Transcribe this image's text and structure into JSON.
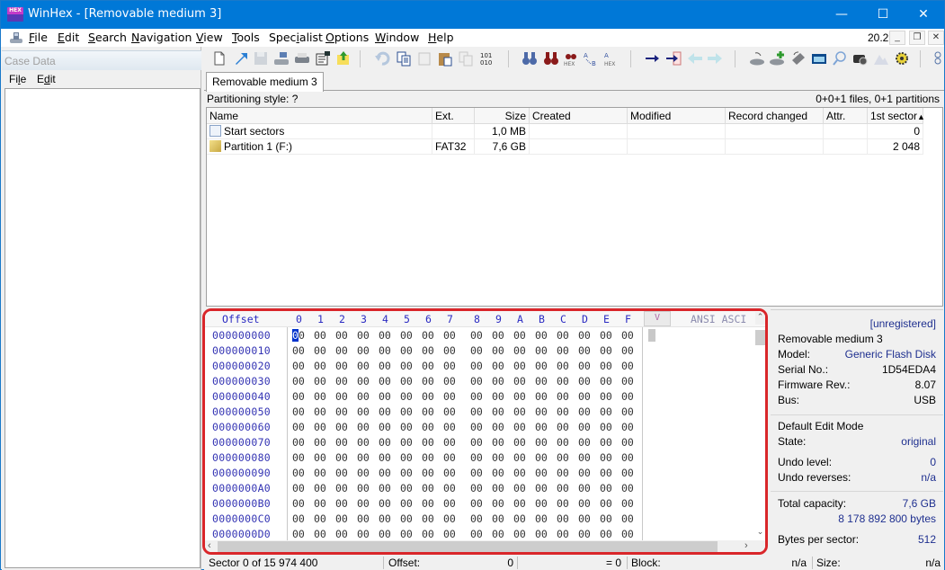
{
  "window": {
    "title": "WinHex - [Removable medium 3]",
    "app_icon": "winhex-logo-icon",
    "app_icon_text": "HEX",
    "controls": {
      "minimize": "—",
      "maximize": "☐",
      "close": "✕"
    }
  },
  "menubar": {
    "items": [
      {
        "label": "File",
        "accel": "F",
        "rest": "ile"
      },
      {
        "label": "Edit",
        "accel": "E",
        "rest": "dit"
      },
      {
        "label": "Search",
        "accel": "S",
        "rest": "earch"
      },
      {
        "label": "Navigation",
        "accel": "N",
        "rest": "avigation"
      },
      {
        "label": "View",
        "accel": "V",
        "rest": "iew"
      },
      {
        "label": "Tools",
        "accel": "T",
        "rest": "ools"
      },
      {
        "label": "Specialist",
        "pre": "Spec",
        "accel": "i",
        "rest": "alist"
      },
      {
        "label": "Options",
        "accel": "O",
        "rest": "ptions"
      },
      {
        "label": "Window",
        "accel": "W",
        "rest": "indow"
      },
      {
        "label": "Help",
        "accel": "H",
        "rest": "elp"
      }
    ],
    "version": "20.2",
    "mdi_controls": {
      "minimize": "_",
      "restore": "🗗",
      "close": "✕"
    }
  },
  "case_panel": {
    "caption": "Case Data",
    "menu": [
      {
        "label": "File",
        "pre": "Fi",
        "accel": "l",
        "rest": "e"
      },
      {
        "label": "Edit",
        "pre": "E",
        "accel": "d",
        "rest": "it"
      }
    ]
  },
  "toolbar": {
    "groups": [
      [
        "new-file-icon",
        "open-icon",
        "save-icon",
        "open-disk-icon",
        "print-icon",
        "properties-icon",
        "export-icon"
      ],
      [
        "undo-icon",
        "copy-block-icon",
        "cut-icon",
        "paste-icon",
        "write-clipboard-icon",
        "convert-binary-icon"
      ],
      [
        "find-text-icon",
        "find-hex-icon",
        "find-hex-values-icon",
        "replace-text-icon",
        "replace-hex-icon"
      ],
      [
        "go-to-offset-icon",
        "go-to-sector-icon",
        "back-icon",
        "forward-icon"
      ],
      [
        "open-disk-2-icon",
        "clone-disk-icon",
        "ram-editor-icon",
        "calculator-icon",
        "analyze-icon",
        "snapshot-icon",
        "gallery-icon",
        "settings-gear-icon"
      ],
      [
        "more-icon"
      ]
    ]
  },
  "tabs": [
    {
      "label": "Removable medium 3",
      "active": true
    }
  ],
  "partitions": {
    "style_label": "Partitioning style: ?",
    "summary": "0+0+1 files, 0+1 partitions",
    "columns": [
      "Name",
      "Ext.",
      "Size",
      "Created",
      "Modified",
      "Record changed",
      "Attr.",
      "1st sector"
    ],
    "sort_column": "1st sector",
    "sort_dir": "ascending",
    "rows": [
      {
        "icon": "sectors-file-icon",
        "name": "Start sectors",
        "ext": "",
        "size": "1,0 MB",
        "created": "",
        "modified": "",
        "record_changed": "",
        "attr": "",
        "first_sector": "0"
      },
      {
        "icon": "partition-icon",
        "name": "Partition 1 (F:)",
        "ext": "FAT32",
        "size": "7,6 GB",
        "created": "",
        "modified": "",
        "record_changed": "",
        "attr": "",
        "first_sector": "2 048"
      }
    ]
  },
  "hex_editor": {
    "offset_header": "Offset",
    "column_headers": [
      "0",
      "1",
      "2",
      "3",
      "4",
      "5",
      "6",
      "7",
      "8",
      "9",
      "A",
      "B",
      "C",
      "D",
      "E",
      "F"
    ],
    "text_mode_toggle": "V",
    "charset_header": "ANSI ASCII",
    "charset_header_visible": "ANSI ASCI",
    "rows": [
      {
        "offset": "000000000",
        "bytes": [
          "00",
          "00",
          "00",
          "00",
          "00",
          "00",
          "00",
          "00",
          "00",
          "00",
          "00",
          "00",
          "00",
          "00",
          "00",
          "00"
        ]
      },
      {
        "offset": "000000010",
        "bytes": [
          "00",
          "00",
          "00",
          "00",
          "00",
          "00",
          "00",
          "00",
          "00",
          "00",
          "00",
          "00",
          "00",
          "00",
          "00",
          "00"
        ]
      },
      {
        "offset": "000000020",
        "bytes": [
          "00",
          "00",
          "00",
          "00",
          "00",
          "00",
          "00",
          "00",
          "00",
          "00",
          "00",
          "00",
          "00",
          "00",
          "00",
          "00"
        ]
      },
      {
        "offset": "000000030",
        "bytes": [
          "00",
          "00",
          "00",
          "00",
          "00",
          "00",
          "00",
          "00",
          "00",
          "00",
          "00",
          "00",
          "00",
          "00",
          "00",
          "00"
        ]
      },
      {
        "offset": "000000040",
        "bytes": [
          "00",
          "00",
          "00",
          "00",
          "00",
          "00",
          "00",
          "00",
          "00",
          "00",
          "00",
          "00",
          "00",
          "00",
          "00",
          "00"
        ]
      },
      {
        "offset": "000000050",
        "bytes": [
          "00",
          "00",
          "00",
          "00",
          "00",
          "00",
          "00",
          "00",
          "00",
          "00",
          "00",
          "00",
          "00",
          "00",
          "00",
          "00"
        ]
      },
      {
        "offset": "000000060",
        "bytes": [
          "00",
          "00",
          "00",
          "00",
          "00",
          "00",
          "00",
          "00",
          "00",
          "00",
          "00",
          "00",
          "00",
          "00",
          "00",
          "00"
        ]
      },
      {
        "offset": "000000070",
        "bytes": [
          "00",
          "00",
          "00",
          "00",
          "00",
          "00",
          "00",
          "00",
          "00",
          "00",
          "00",
          "00",
          "00",
          "00",
          "00",
          "00"
        ]
      },
      {
        "offset": "000000080",
        "bytes": [
          "00",
          "00",
          "00",
          "00",
          "00",
          "00",
          "00",
          "00",
          "00",
          "00",
          "00",
          "00",
          "00",
          "00",
          "00",
          "00"
        ]
      },
      {
        "offset": "000000090",
        "bytes": [
          "00",
          "00",
          "00",
          "00",
          "00",
          "00",
          "00",
          "00",
          "00",
          "00",
          "00",
          "00",
          "00",
          "00",
          "00",
          "00"
        ]
      },
      {
        "offset": "0000000A0",
        "bytes": [
          "00",
          "00",
          "00",
          "00",
          "00",
          "00",
          "00",
          "00",
          "00",
          "00",
          "00",
          "00",
          "00",
          "00",
          "00",
          "00"
        ]
      },
      {
        "offset": "0000000B0",
        "bytes": [
          "00",
          "00",
          "00",
          "00",
          "00",
          "00",
          "00",
          "00",
          "00",
          "00",
          "00",
          "00",
          "00",
          "00",
          "00",
          "00"
        ]
      },
      {
        "offset": "0000000C0",
        "bytes": [
          "00",
          "00",
          "00",
          "00",
          "00",
          "00",
          "00",
          "00",
          "00",
          "00",
          "00",
          "00",
          "00",
          "00",
          "00",
          "00"
        ]
      },
      {
        "offset": "0000000D0",
        "bytes": [
          "00",
          "00",
          "00",
          "00",
          "00",
          "00",
          "00",
          "00",
          "00",
          "00",
          "00",
          "00",
          "00",
          "00",
          "00",
          "00"
        ]
      }
    ],
    "cursor": {
      "row": 0,
      "col": 0
    },
    "highlight_color": "#d9262a"
  },
  "info_panel": {
    "registration": "[unregistered]",
    "device_name": "Removable medium 3",
    "device_fields": [
      {
        "label": "Model:",
        "value": "Generic Flash Disk",
        "blue": true
      },
      {
        "label": "Serial No.:",
        "value": "1D54EDA4",
        "blue": false
      },
      {
        "label": "Firmware Rev.:",
        "value": "8.07",
        "blue": false
      },
      {
        "label": "Bus:",
        "value": "USB",
        "blue": false
      }
    ],
    "edit_mode": "Default Edit Mode",
    "state_label": "State:",
    "state_value": "original",
    "undo_level_label": "Undo level:",
    "undo_level_value": "0",
    "undo_reverses_label": "Undo reverses:",
    "undo_reverses_value": "n/a",
    "total_capacity_label": "Total capacity:",
    "total_capacity_value": "7,6 GB",
    "total_capacity_bytes": "8 178 892 800 bytes",
    "bytes_per_sector_label": "Bytes per sector:",
    "bytes_per_sector_value": "512"
  },
  "statusbar": {
    "sector": "Sector 0 of 15 974 400",
    "offset_label": "Offset:",
    "offset_value": "0",
    "value_eq": "= 0",
    "block_label": "Block:",
    "block_value": "n/a",
    "size_label": "Size:",
    "size_value": "n/a"
  }
}
